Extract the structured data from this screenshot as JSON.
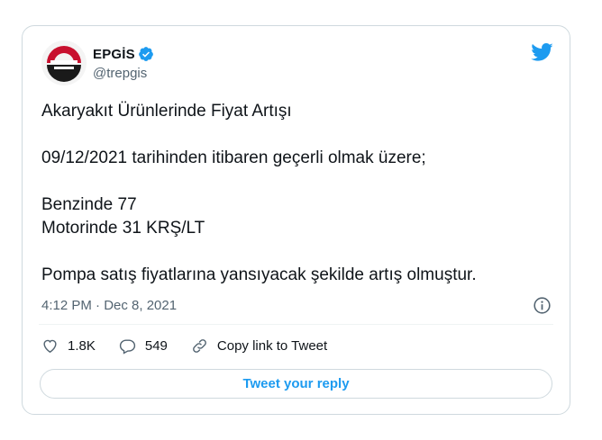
{
  "account": {
    "display_name": "EPGİS",
    "handle": "@trepgis",
    "verified": true
  },
  "tweet": {
    "lines": [
      "Akaryakıt Ürünlerinde Fiyat Artışı",
      "",
      "09/12/2021 tarihinden itibaren geçerli olmak üzere;",
      "",
      "Benzinde 77",
      "Motorinde 31 KRŞ/LT",
      "",
      "Pompa satış fiyatlarına yansıyacak şekilde artış olmuştur."
    ],
    "timestamp": "4:12 PM · Dec 8, 2021"
  },
  "actions": {
    "likes": "1.8K",
    "replies": "549",
    "copy_link_label": "Copy link to Tweet"
  },
  "reply_button_label": "Tweet your reply",
  "icons": {
    "brand": "twitter-bird-icon",
    "verified": "verified-badge-icon",
    "info": "info-icon",
    "like": "heart-icon",
    "reply": "speech-bubble-icon",
    "link": "link-icon"
  },
  "colors": {
    "accent": "#1d9bf0",
    "logo_red": "#c8102e",
    "text": "#0f1419",
    "muted": "#536471",
    "border": "#cfd9de"
  }
}
